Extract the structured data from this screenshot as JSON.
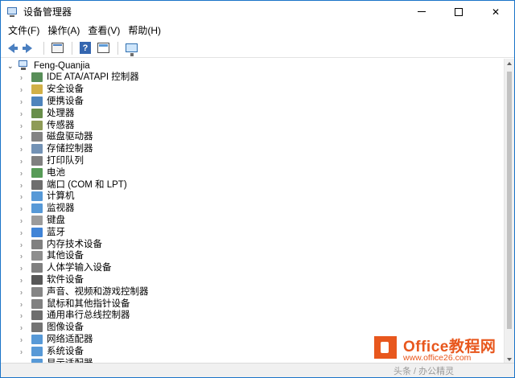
{
  "window": {
    "title": "设备管理器"
  },
  "window_controls": {
    "minimize_label": "",
    "maximize_label": "",
    "close_label": "✕"
  },
  "menu": [
    "文件(F)",
    "操作(A)",
    "查看(V)",
    "帮助(H)"
  ],
  "toolbar": {
    "buttons": [
      "back-icon",
      "forward-icon",
      "properties-icon",
      "help-icon",
      "update-driver-icon",
      "scan-hardware-icon"
    ]
  },
  "tree": {
    "root": "Feng-Quanjia",
    "expanded_chevron": "⌄",
    "collapsed_chevron": "›",
    "items": [
      {
        "label": "IDE ATA/ATAPI 控制器",
        "icon": "ide-controller-icon",
        "color": "#3b7a3b"
      },
      {
        "label": "安全设备",
        "icon": "security-device-icon",
        "color": "#c9a227"
      },
      {
        "label": "便携设备",
        "icon": "portable-device-icon",
        "color": "#2f6fb0"
      },
      {
        "label": "处理器",
        "icon": "processor-icon",
        "color": "#4d7a2a"
      },
      {
        "label": "传感器",
        "icon": "sensor-icon",
        "color": "#7a8a3a"
      },
      {
        "label": "磁盘驱动器",
        "icon": "disk-drive-icon",
        "color": "#6d6d6d"
      },
      {
        "label": "存储控制器",
        "icon": "storage-controller-icon",
        "color": "#5b7fa8"
      },
      {
        "label": "打印队列",
        "icon": "print-queue-icon",
        "color": "#6a6a6a"
      },
      {
        "label": "电池",
        "icon": "battery-icon",
        "color": "#3a8a3a"
      },
      {
        "label": "端口 (COM 和 LPT)",
        "icon": "port-icon",
        "color": "#555555"
      },
      {
        "label": "计算机",
        "icon": "computer-icon",
        "color": "#3a87d0"
      },
      {
        "label": "监视器",
        "icon": "monitor-icon",
        "color": "#3a87d0"
      },
      {
        "label": "键盘",
        "icon": "keyboard-icon",
        "color": "#8a8a8a"
      },
      {
        "label": "蓝牙",
        "icon": "bluetooth-icon",
        "color": "#1e6fd0"
      },
      {
        "label": "内存技术设备",
        "icon": "memory-device-icon",
        "color": "#6a6a6a"
      },
      {
        "label": "其他设备",
        "icon": "other-device-icon",
        "color": "#7a7a7a"
      },
      {
        "label": "人体学输入设备",
        "icon": "hid-icon",
        "color": "#6a6a6a"
      },
      {
        "label": "软件设备",
        "icon": "software-device-icon",
        "color": "#3a3a3a"
      },
      {
        "label": "声音、视频和游戏控制器",
        "icon": "sound-icon",
        "color": "#707070"
      },
      {
        "label": "鼠标和其他指针设备",
        "icon": "mouse-icon",
        "color": "#6a6a6a"
      },
      {
        "label": "通用串行总线控制器",
        "icon": "usb-icon",
        "color": "#555555"
      },
      {
        "label": "图像设备",
        "icon": "imaging-device-icon",
        "color": "#5a5a5a"
      },
      {
        "label": "网络适配器",
        "icon": "network-adapter-icon",
        "color": "#3a87d0"
      },
      {
        "label": "系统设备",
        "icon": "system-device-icon",
        "color": "#3a87d0"
      },
      {
        "label": "显示适配器",
        "icon": "display-adapter-icon",
        "color": "#3a87d0"
      }
    ]
  },
  "watermark": {
    "brand": "Office教程网",
    "url": "www.office26.com",
    "tag": "头条 / 办公精灵"
  },
  "colors": {
    "accent": "#1a73c8",
    "watermark": "#e8571d"
  }
}
